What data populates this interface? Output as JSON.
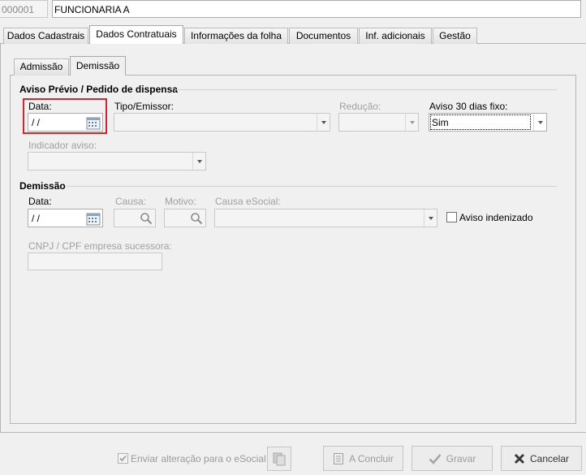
{
  "header": {
    "code": "000001",
    "name": "FUNCIONARIA A"
  },
  "main_tabs": [
    {
      "label": "Dados Cadastrais"
    },
    {
      "label": "Dados Contratuais"
    },
    {
      "label": "Informações da folha"
    },
    {
      "label": "Documentos"
    },
    {
      "label": "Inf. adicionais"
    },
    {
      "label": "Gestão"
    }
  ],
  "sub_tabs": [
    {
      "label": "Admissão"
    },
    {
      "label": "Demissão"
    }
  ],
  "aviso": {
    "section_title": "Aviso Prévio / Pedido de dispensa",
    "data_label": "Data:",
    "data_value": " /  /",
    "tipo_label": "Tipo/Emissor:",
    "tipo_value": "",
    "reducao_label": "Redução:",
    "reducao_value": "",
    "aviso30_label": "Aviso 30 dias fixo:",
    "aviso30_value": "Sim",
    "indicador_label": "Indicador aviso:",
    "indicador_value": ""
  },
  "demissao": {
    "section_title": "Demissão",
    "data_label": "Data:",
    "data_value": " /  /",
    "causa_label": "Causa:",
    "motivo_label": "Motivo:",
    "causa_esocial_label": "Causa eSocial:",
    "aviso_indenizado_label": "Aviso indenizado",
    "aviso_indenizado_checked": false,
    "cnpj_label": "CNPJ / CPF empresa sucessora:",
    "cnpj_value": ""
  },
  "footer": {
    "enviar_label": "Enviar alteração para o eSocial",
    "enviar_checked": true,
    "concluir_label": "A Concluir",
    "gravar_label": "Gravar",
    "cancelar_label": "Cancelar"
  },
  "colors": {
    "highlight": "#d9232d",
    "disabled_text": "#a0a0a0",
    "cancel_icon": "#333333"
  }
}
